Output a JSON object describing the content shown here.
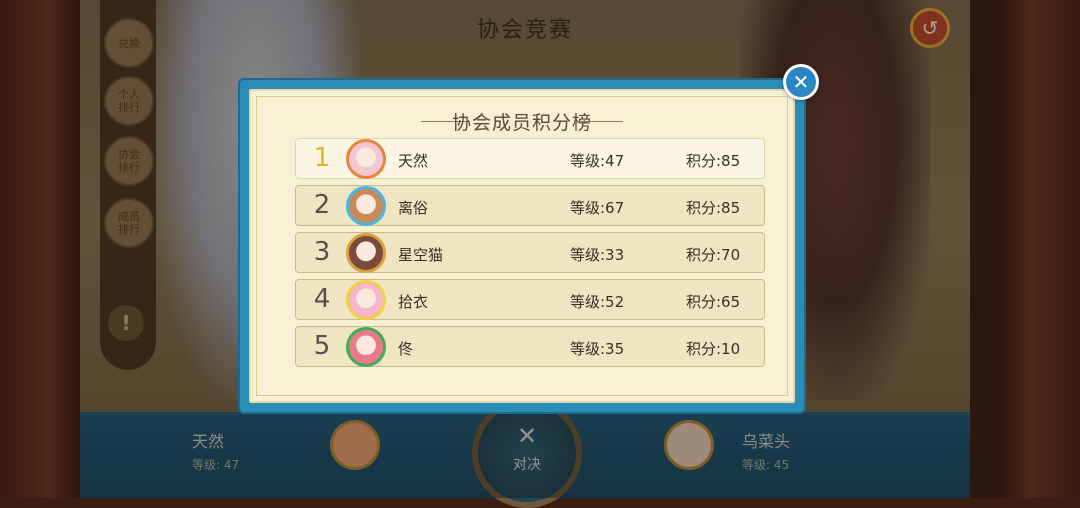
{
  "background": {
    "screen_title": "协会竞赛",
    "side_menu": [
      {
        "label": "兑换"
      },
      {
        "label": "个人\n排行"
      },
      {
        "label": "协会\n排行"
      },
      {
        "label": "成员\n排行"
      }
    ],
    "warning_glyph": "!",
    "back_glyph": "↺",
    "left_player": {
      "name": "天然",
      "level_text": "等级: 47"
    },
    "right_player": {
      "name": "乌菜头",
      "level_text": "等级: 45"
    },
    "vs_label": "对决",
    "vs_icon": "crossed-utensils-icon"
  },
  "modal": {
    "title": "协会成员积分榜",
    "close_glyph": "✕",
    "rows": [
      {
        "rank": "1",
        "name": "天然",
        "level": "等级:47",
        "score": "积分:85",
        "avatar_color": "#e8843a",
        "avatar_bg": "#f2c7d0"
      },
      {
        "rank": "2",
        "name": "离俗",
        "level": "等级:67",
        "score": "积分:85",
        "avatar_color": "#4ab6e0",
        "avatar_bg": "#c98a5a"
      },
      {
        "rank": "3",
        "name": "星空猫",
        "level": "等级:33",
        "score": "积分:70",
        "avatar_color": "#d9a040",
        "avatar_bg": "#7a4a3a"
      },
      {
        "rank": "4",
        "name": "拾衣",
        "level": "等级:52",
        "score": "积分:65",
        "avatar_color": "#f2d040",
        "avatar_bg": "#f4b6c8"
      },
      {
        "rank": "5",
        "name": "佟",
        "level": "等级:35",
        "score": "积分:10",
        "avatar_color": "#3fae5a",
        "avatar_bg": "#e87a8a"
      }
    ]
  },
  "colors": {
    "modal_border": "#2a8db5",
    "modal_paper": "#f7f0d2",
    "first_rank": "#e6b422"
  }
}
